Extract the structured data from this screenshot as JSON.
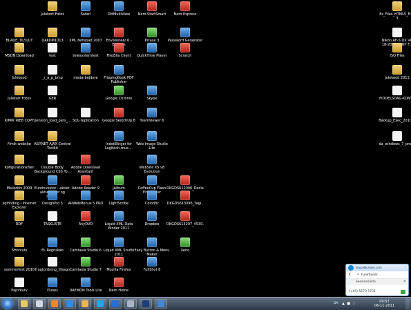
{
  "desktop": {
    "icons": [
      {
        "label": "Julekort Fotos",
        "icon": "folder-icon",
        "kind": "folder"
      },
      {
        "label": "Safari",
        "icon": "safari-icon",
        "kind": "app"
      },
      {
        "label": "DMMultiView",
        "icon": "app-icon",
        "kind": "app"
      },
      {
        "label": "Nero StartSmart",
        "icon": "nero-icon",
        "kind": "red"
      },
      {
        "label": "Nero Express",
        "icon": "nero-icon",
        "kind": "red"
      },
      {
        "label": "Es_Files_HTML5_Find3",
        "icon": "folder-icon",
        "kind": "folder"
      },
      {
        "label": "BLADE_TIL5LUT",
        "icon": "folder-icon",
        "kind": "folder"
      },
      {
        "label": "QAKOM1013",
        "icon": "folder-icon",
        "kind": "folder"
      },
      {
        "label": "XML Notepad 2007",
        "icon": "xml-icon",
        "kind": "app"
      },
      {
        "label": "Envisioneer 6 - Express",
        "icon": "house-icon",
        "kind": "red"
      },
      {
        "label": "Picasa 3",
        "icon": "picasa-icon",
        "kind": "grn"
      },
      {
        "label": "Password Generator",
        "icon": "key-icon",
        "kind": "app"
      },
      {
        "label": "Nikon AF-S DX VR 18-200mm NY F...",
        "icon": "document-icon",
        "kind": "doc"
      },
      {
        "label": "MSDN Download",
        "icon": "folder-icon",
        "kind": "folder"
      },
      {
        "label": "test",
        "icon": "document-icon",
        "kind": "doc"
      },
      {
        "label": "telesystemtest",
        "icon": "app-icon",
        "kind": "app"
      },
      {
        "label": "FileZilla Client",
        "icon": "filezilla-icon",
        "kind": "red"
      },
      {
        "label": "QuickTime Player",
        "icon": "quicktime-icon",
        "kind": "app"
      },
      {
        "label": "Scratch",
        "icon": "scratch-icon",
        "kind": "red"
      },
      {
        "label": "ISO Files",
        "icon": "folder-icon",
        "kind": "folder"
      },
      {
        "label": "Julekood",
        "icon": "folder-icon",
        "kind": "folder"
      },
      {
        "label": "_r_a_p_bmp",
        "icon": "document-icon",
        "kind": "doc"
      },
      {
        "label": "medarbejdere",
        "icon": "folder-icon",
        "kind": "folder"
      },
      {
        "label": "FlippingBook PDF Publisher",
        "icon": "book-icon",
        "kind": "app"
      },
      {
        "label": "julekood 2011",
        "icon": "folder-icon",
        "kind": "folder"
      },
      {
        "label": "Julekort Fotos",
        "icon": "folder-icon",
        "kind": "folder"
      },
      {
        "label": "GER",
        "icon": "document-icon",
        "kind": "doc"
      },
      {
        "label": "Google Chrome",
        "icon": "chrome-icon",
        "kind": "grn"
      },
      {
        "label": "Skype",
        "icon": "skype-icon",
        "kind": "app"
      },
      {
        "label": "FIDDELSDAG-KONT...",
        "icon": "document-icon",
        "kind": "doc"
      },
      {
        "label": "KIMIK WEB COPY",
        "icon": "folder-icon",
        "kind": "folder"
      },
      {
        "label": "pension_load_pers_...",
        "icon": "document-icon",
        "kind": "doc"
      },
      {
        "label": "SQL-replication",
        "icon": "document-icon",
        "kind": "doc"
      },
      {
        "label": "Google SketchUp 8",
        "icon": "sketchup-icon",
        "kind": "red"
      },
      {
        "label": "TeamViewer 6",
        "icon": "teamviewer-icon",
        "kind": "app"
      },
      {
        "label": "Backup_Exec_2010_...",
        "icon": "document-icon",
        "kind": "doc"
      },
      {
        "label": "Fimik website",
        "icon": "folder-icon",
        "kind": "folder"
      },
      {
        "label": "ASP.NET AJAX Control Toolkit",
        "icon": "folder-icon",
        "kind": "folder"
      },
      {
        "label": "IndstillInger for Logitech-mus-...",
        "icon": "mouse-icon",
        "kind": "app"
      },
      {
        "label": "Web Image Studio Lite",
        "icon": "app-icon",
        "kind": "app"
      },
      {
        "label": "da_windows_7_profe...",
        "icon": "document-icon",
        "kind": "doc"
      },
      {
        "label": "Kofigurationsfiler",
        "icon": "folder-icon",
        "kind": "folder"
      },
      {
        "label": "Double Body Background CSS To...",
        "icon": "document-icon",
        "kind": "doc"
      },
      {
        "label": "Adobe Download Assistant",
        "icon": "adobe-icon",
        "kind": "red"
      },
      {
        "label": "WebSite X5 v8 Evolution",
        "icon": "app-icon",
        "kind": "app"
      },
      {
        "label": "Mailarkiv 2009",
        "icon": "folder-icon",
        "kind": "folder"
      },
      {
        "label": "Euroinvestor - aktier, aktiekurser og nyhe...",
        "icon": "app-icon",
        "kind": "app"
      },
      {
        "label": "Adobe Reader 9",
        "icon": "adobe-icon",
        "kind": "red"
      },
      {
        "label": "jAlbum",
        "icon": "app-icon",
        "kind": "grn"
      },
      {
        "label": "CoffeeCup Flash FireStarter",
        "icon": "app-icon",
        "kind": "app"
      },
      {
        "label": "DKGDS612006_Decla...",
        "icon": "pdf-icon",
        "kind": "red"
      },
      {
        "label": "sqlfinding i Internet Explorer",
        "icon": "folder-icon",
        "kind": "folder"
      },
      {
        "label": "DesignPro 5",
        "icon": "app-icon",
        "kind": "app"
      },
      {
        "label": "ARWebMenus 5 PRO",
        "icon": "app-icon",
        "kind": "app"
      },
      {
        "label": "LightScribe",
        "icon": "app-icon",
        "kind": "app"
      },
      {
        "label": "ColorPic",
        "icon": "app-icon",
        "kind": "app"
      },
      {
        "label": "DKGDS613096_Tagi...",
        "icon": "pdf-icon",
        "kind": "red"
      },
      {
        "label": "RDF",
        "icon": "folder-icon",
        "kind": "folder"
      },
      {
        "label": "TASKLISTE",
        "icon": "document-icon",
        "kind": "doc"
      },
      {
        "label": "AnyDVD",
        "icon": "app-icon",
        "kind": "red"
      },
      {
        "label": "Liquid XML Data Binder 2011",
        "icon": "app-icon",
        "kind": "app"
      },
      {
        "label": "Dropbox",
        "icon": "dropbox-icon",
        "kind": "app"
      },
      {
        "label": "DKGDS613297_4530...",
        "icon": "pdf-icon",
        "kind": "red"
      },
      {
        "label": "SHorcuts",
        "icon": "folder-icon",
        "kind": "folder"
      },
      {
        "label": "EL Regnskab",
        "icon": "app-icon",
        "kind": "app"
      },
      {
        "label": "Camtasia Studio 6",
        "icon": "camtasia-icon",
        "kind": "grn"
      },
      {
        "label": "Liquid XML Studio 2011",
        "icon": "app-icon",
        "kind": "app"
      },
      {
        "label": "Easy Button & Menu Maker",
        "icon": "app-icon",
        "kind": "app"
      },
      {
        "label": "Xeno",
        "icon": "app-icon",
        "kind": "grn"
      },
      {
        "label": "sommerfest 2010",
        "icon": "folder-icon",
        "kind": "folder"
      },
      {
        "label": "frugtordning_tilsagn",
        "icon": "document-icon",
        "kind": "doc"
      },
      {
        "label": "Camtasia Studio 7",
        "icon": "camtasia-icon",
        "kind": "grn"
      },
      {
        "label": "Mozilla Firefox",
        "icon": "firefox-icon",
        "kind": "red"
      },
      {
        "label": "FullShot 8",
        "icon": "app-icon",
        "kind": "app"
      },
      {
        "label": "Papirkurv",
        "icon": "recycle-bin-icon",
        "kind": "doc"
      },
      {
        "label": "iTunes",
        "icon": "itunes-icon",
        "kind": "app"
      },
      {
        "label": "DAEMON Tools Lite",
        "icon": "daemon-icon",
        "kind": "app"
      },
      {
        "label": "Nero Home",
        "icon": "nero-icon",
        "kind": "red"
      }
    ]
  },
  "skype_popup": {
    "title": "SkypeNumber.com",
    "row_label": "Funktioner",
    "session_label": "Sessionsliste",
    "phone_number": "(+45) 5573 5731",
    "minimize": "–",
    "close": "✕"
  },
  "taskbar": {
    "items": [
      {
        "name": "taskbar-explorer",
        "color": "#e8c96a"
      },
      {
        "name": "taskbar-document",
        "color": "#cfd8e3"
      },
      {
        "name": "taskbar-media-player",
        "color": "#f08a2a"
      },
      {
        "name": "taskbar-internet-explorer",
        "color": "#2f8ce8"
      },
      {
        "name": "taskbar-outlook",
        "color": "#f2b64a"
      },
      {
        "name": "taskbar-skype",
        "color": "#23a5ef"
      },
      {
        "name": "taskbar-word",
        "color": "#2b6cd0"
      },
      {
        "name": "taskbar-app",
        "color": "#aab6c6"
      },
      {
        "name": "taskbar-photoshop",
        "color": "#1b3d7a"
      },
      {
        "name": "taskbar-teamviewer",
        "color": "#3c8ad9"
      }
    ],
    "language": "DA",
    "tray_icons": "▲ ■ ♪",
    "time": "09:57",
    "date": "06-11-2011"
  }
}
